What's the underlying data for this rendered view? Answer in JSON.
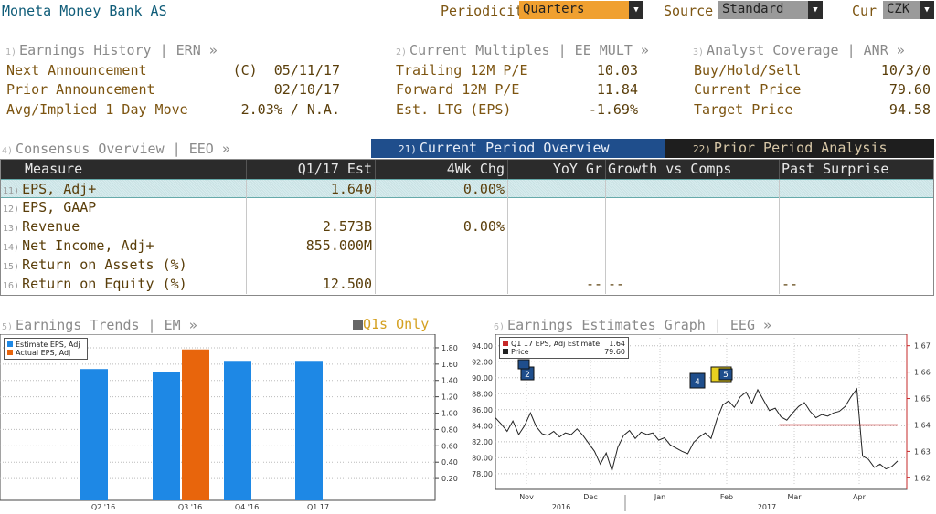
{
  "header": {
    "company": "Moneta Money Bank AS",
    "periodicity_label": "Periodicity",
    "periodicity_value": "Quarters",
    "source_label": "Source",
    "source_value": "Standard",
    "currency_label": "Cur",
    "currency_value": "CZK"
  },
  "earnings_history": {
    "num": "1)",
    "title": "Earnings History | ERN »",
    "rows": [
      {
        "label": "Next Announcement",
        "value": "(C)  05/11/17"
      },
      {
        "label": "Prior Announcement",
        "value": "02/10/17"
      },
      {
        "label": "Avg/Implied 1 Day Move",
        "value": "2.03% / N.A."
      }
    ]
  },
  "current_multiples": {
    "num": "2)",
    "title": "Current Multiples | EE MULT »",
    "rows": [
      {
        "label": "Trailing 12M P/E",
        "value": "10.03"
      },
      {
        "label": "Forward 12M P/E",
        "value": "11.84"
      },
      {
        "label": "Est. LTG (EPS)",
        "value": "-1.69%"
      }
    ]
  },
  "analyst_coverage": {
    "num": "3)",
    "title": "Analyst Coverage | ANR »",
    "rows": [
      {
        "label": "Buy/Hold/Sell",
        "value": "10/3/0"
      },
      {
        "label": "Current Price",
        "value": "79.60"
      },
      {
        "label": "Target Price",
        "value": "94.58"
      }
    ]
  },
  "consensus": {
    "num": "4)",
    "title": "Consensus Overview | EEO »",
    "tab_current_num": "21)",
    "tab_current": "Current Period Overview (Q1/17)",
    "tab_prior_num": "22)",
    "tab_prior": "Prior Period Analysis (Q4/16)"
  },
  "table": {
    "columns": [
      "Measure",
      "Q1/17 Est",
      "4Wk Chg",
      "YoY Gr",
      "Growth vs Comps",
      "Past Surprise"
    ],
    "rows": [
      {
        "num": "11)",
        "measure": "EPS, Adj+",
        "est": "1.640",
        "chg": "0.00%",
        "yoy": "",
        "comps": "",
        "surprise": ""
      },
      {
        "num": "12)",
        "measure": "EPS, GAAP",
        "est": "",
        "chg": "",
        "yoy": "",
        "comps": "",
        "surprise": ""
      },
      {
        "num": "13)",
        "measure": "Revenue",
        "est": "2.573B",
        "chg": "0.00%",
        "yoy": "",
        "comps": "",
        "surprise": ""
      },
      {
        "num": "14)",
        "measure": "Net Income, Adj+",
        "est": "855.000M",
        "chg": "",
        "yoy": "",
        "comps": "",
        "surprise": ""
      },
      {
        "num": "15)",
        "measure": "Return on Assets (%)",
        "est": "",
        "chg": "",
        "yoy": "",
        "comps": "",
        "surprise": ""
      },
      {
        "num": "16)",
        "measure": "Return on Equity (%)",
        "est": "12.500",
        "chg": "",
        "yoy": "--",
        "comps": "--",
        "surprise": "--"
      }
    ]
  },
  "trends": {
    "num": "5)",
    "title": "Earnings Trends | EM »",
    "toggle": "Q1s Only"
  },
  "estimates": {
    "num": "6)",
    "title": "Earnings Estimates Graph | EEG »"
  },
  "colors": {
    "estimate": "#1e88e5",
    "actual": "#e8650c",
    "price_line": "#222222",
    "estimate_line": "#c62828",
    "tab_active": "#1f4e8c",
    "dropdown_orange": "#f0a030",
    "dropdown_grey": "#9a9a9a"
  },
  "chart_data": [
    {
      "type": "bar",
      "categories": [
        "Q2 '16",
        "Q3 '16",
        "Q4 '16",
        "Q1 17"
      ],
      "series": [
        {
          "name": "Estimate EPS, Adj",
          "values": [
            1.54,
            1.5,
            1.64,
            1.64
          ]
        },
        {
          "name": "Actual EPS, Adj",
          "values": [
            null,
            1.78,
            null,
            null
          ]
        }
      ],
      "y_ticks": [
        "1.80",
        "1.60",
        "1.40",
        "1.20",
        "1.00",
        "0.80",
        "0.60",
        "0.40",
        "0.20"
      ],
      "ylim": [
        0,
        1.9
      ]
    },
    {
      "type": "line",
      "legend": [
        {
          "name": "Q1 17 EPS, Adj Estimate",
          "value": "1.64"
        },
        {
          "name": "Price",
          "value": "79.60"
        }
      ],
      "x_ticks": [
        "Nov",
        "Dec",
        "Jan",
        "Feb",
        "Mar",
        "Apr"
      ],
      "x_years": [
        "2016",
        "2017"
      ],
      "left_ticks": [
        "94.00",
        "92.00",
        "90.00",
        "88.00",
        "86.00",
        "84.00",
        "82.00",
        "80.00",
        "78.00"
      ],
      "right_ticks": [
        "1.67",
        "1.66",
        "1.65",
        "1.64",
        "1.63",
        "1.62"
      ],
      "left_ylim": [
        76.5,
        95
      ],
      "right_ylim": [
        1.617,
        1.673
      ],
      "price": [
        85.0,
        84.2,
        83.3,
        84.6,
        82.9,
        84.0,
        85.6,
        83.9,
        83.0,
        82.8,
        83.3,
        82.6,
        83.1,
        82.9,
        83.6,
        82.8,
        81.8,
        80.8,
        79.2,
        80.6,
        78.4,
        81.3,
        82.8,
        83.4,
        82.4,
        83.2,
        82.9,
        83.1,
        82.2,
        82.5,
        81.6,
        81.2,
        80.8,
        80.5,
        81.9,
        82.6,
        83.1,
        82.4,
        84.8,
        86.6,
        87.1,
        86.3,
        87.6,
        88.2,
        86.8,
        88.5,
        87.2,
        85.9,
        86.2,
        85.1,
        84.7,
        85.6,
        86.4,
        86.9,
        85.8,
        85.0,
        85.4,
        85.2,
        85.6,
        85.8,
        86.4,
        87.6,
        88.6,
        80.2,
        79.8,
        78.8,
        79.2,
        78.6,
        78.9,
        79.6
      ],
      "estimate": {
        "value": 1.64,
        "start_fraction": 0.69
      }
    }
  ]
}
